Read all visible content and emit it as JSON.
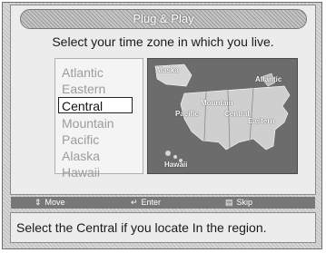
{
  "header": {
    "title": "Plug & Play"
  },
  "prompt": "Select your time zone in which you live.",
  "time_zones": {
    "items": [
      "Atlantic",
      "Eastern",
      "Central",
      "Mountain",
      "Pacific",
      "Alaska",
      "Hawaii"
    ],
    "selected": "Central"
  },
  "map": {
    "labels": {
      "alaska": "Alaska",
      "atlantic": "Atlantic",
      "pacific": "Pacific",
      "mountain": "Mountain",
      "central": "Central",
      "eastern": "Eastern",
      "hawaii": "Hawaii"
    }
  },
  "footer": {
    "move_label": "Move",
    "enter_label": "Enter",
    "skip_label": "Skip",
    "move_icon": "up-down-arrows-icon",
    "enter_icon": "enter-icon",
    "skip_icon": "skip-icon"
  },
  "status": "Select the Central  if you locate In the region."
}
